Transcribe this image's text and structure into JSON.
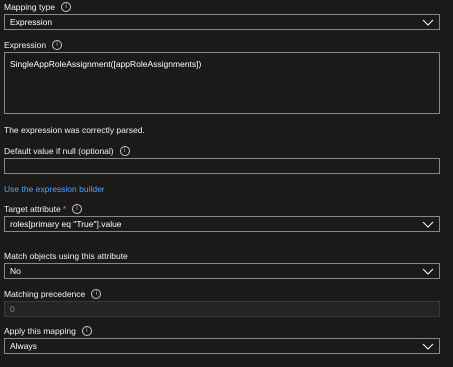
{
  "mapping_type": {
    "label": "Mapping type",
    "value": "Expression"
  },
  "expression": {
    "label": "Expression",
    "value": "SingleAppRoleAssignment([appRoleAssignments])"
  },
  "parse_status": "The expression was correctly parsed.",
  "default_value": {
    "label": "Default value if null (optional)",
    "value": ""
  },
  "expression_builder_link": "Use the expression builder",
  "target_attribute": {
    "label": "Target attribute",
    "required_mark": "*",
    "value": "roles[primary eq \"True\"].value"
  },
  "match_objects": {
    "label": "Match objects using this attribute",
    "value": "No"
  },
  "matching_precedence": {
    "label": "Matching precedence",
    "value": "0"
  },
  "apply_mapping": {
    "label": "Apply this mapping",
    "value": "Always"
  },
  "info_glyph": "i",
  "colors": {
    "background": "#1b1a19",
    "border": "#8a8886",
    "link": "#4fa3ff",
    "required": "#f1707b"
  }
}
